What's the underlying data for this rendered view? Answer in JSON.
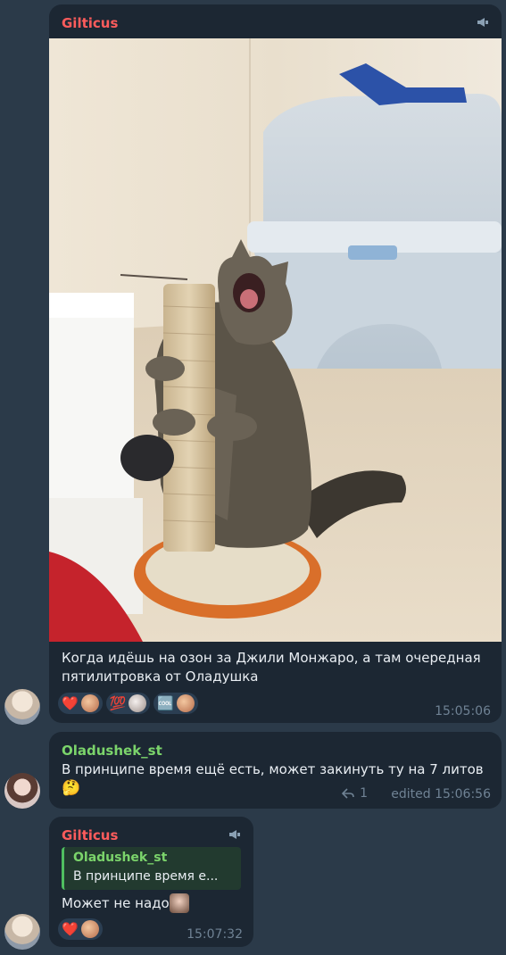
{
  "messages": [
    {
      "sender": "Gilticus",
      "sender_color": "#ff5c5c",
      "text_line1": "Когда идёшь на озон за Джили Монжаро, а там очередная",
      "text_line2": "пятилитровка от Оладушка",
      "reactions": [
        {
          "emoji": "❤️"
        },
        {
          "emoji": "💯"
        },
        {
          "emoji": "🆒"
        }
      ],
      "time": "15:05:06"
    },
    {
      "sender": "Oladushek_st",
      "sender_color": "#7bd46b",
      "text": "В принципе время ещё есть, может закинуть ту на 7 литов",
      "emoji": "🤔",
      "reply_count": "1",
      "time": "edited 15:06:56"
    },
    {
      "sender": "Gilticus",
      "sender_color": "#ff5c5c",
      "quote_sender": "Oladushek_st",
      "quote_text": "В принципе время е...",
      "text": "Может не надо",
      "reactions": [
        {
          "emoji": "❤️"
        }
      ],
      "time": "15:07:32"
    }
  ],
  "colors": {
    "background": "#2b3a49",
    "bubble": "#1c2733",
    "accent_green": "#4fbe60",
    "time": "#6f8294"
  }
}
